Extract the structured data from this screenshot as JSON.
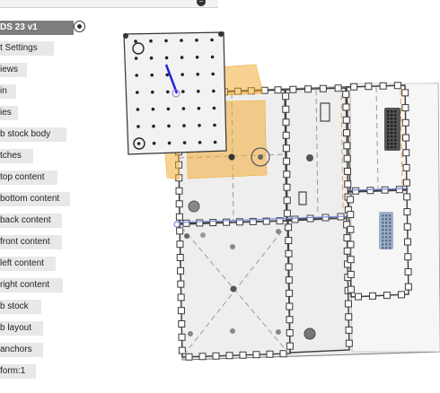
{
  "topbar": {
    "close_glyph": "−"
  },
  "component": {
    "label": "DS 23 v1",
    "activate_icon": "radio-active-icon"
  },
  "browser_items": [
    "t Settings",
    "iews",
    "in",
    "ies",
    "b  stock body",
    "tches",
    "top content",
    "bottom content",
    "back content",
    "front content",
    "left content",
    "right content",
    "b  stock",
    "b  layout",
    "anchors",
    "form:1"
  ],
  "colors": {
    "panel": "#f1f1f1",
    "tab_outline": "#4a4a4a",
    "selection_orange": "#f4a623",
    "axis_blue": "#1e28d8",
    "construction_dash": "#9a9a9a",
    "browser_highlight": "#7d7d7d"
  }
}
